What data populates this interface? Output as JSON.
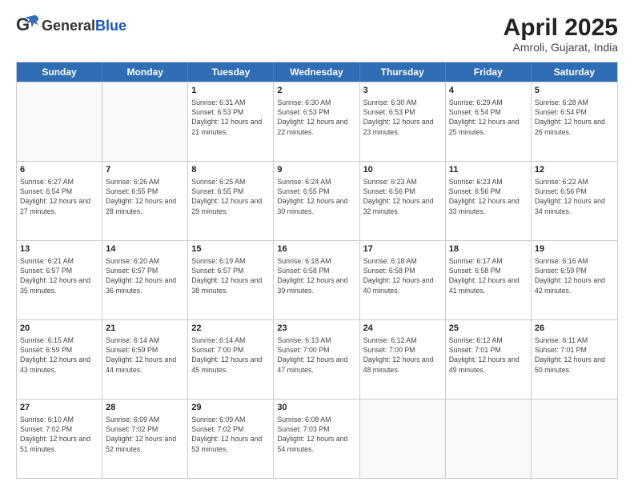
{
  "header": {
    "logo_general": "General",
    "logo_blue": "Blue",
    "month_year": "April 2025",
    "location": "Amroli, Gujarat, India"
  },
  "days_of_week": [
    "Sunday",
    "Monday",
    "Tuesday",
    "Wednesday",
    "Thursday",
    "Friday",
    "Saturday"
  ],
  "weeks": [
    [
      {
        "day": "",
        "sunrise": "",
        "sunset": "",
        "daylight": ""
      },
      {
        "day": "",
        "sunrise": "",
        "sunset": "",
        "daylight": ""
      },
      {
        "day": "1",
        "sunrise": "Sunrise: 6:31 AM",
        "sunset": "Sunset: 6:53 PM",
        "daylight": "Daylight: 12 hours and 21 minutes."
      },
      {
        "day": "2",
        "sunrise": "Sunrise: 6:30 AM",
        "sunset": "Sunset: 6:53 PM",
        "daylight": "Daylight: 12 hours and 22 minutes."
      },
      {
        "day": "3",
        "sunrise": "Sunrise: 6:30 AM",
        "sunset": "Sunset: 6:53 PM",
        "daylight": "Daylight: 12 hours and 23 minutes."
      },
      {
        "day": "4",
        "sunrise": "Sunrise: 6:29 AM",
        "sunset": "Sunset: 6:54 PM",
        "daylight": "Daylight: 12 hours and 25 minutes."
      },
      {
        "day": "5",
        "sunrise": "Sunrise: 6:28 AM",
        "sunset": "Sunset: 6:54 PM",
        "daylight": "Daylight: 12 hours and 26 minutes."
      }
    ],
    [
      {
        "day": "6",
        "sunrise": "Sunrise: 6:27 AM",
        "sunset": "Sunset: 6:54 PM",
        "daylight": "Daylight: 12 hours and 27 minutes."
      },
      {
        "day": "7",
        "sunrise": "Sunrise: 6:26 AM",
        "sunset": "Sunset: 6:55 PM",
        "daylight": "Daylight: 12 hours and 28 minutes."
      },
      {
        "day": "8",
        "sunrise": "Sunrise: 6:25 AM",
        "sunset": "Sunset: 6:55 PM",
        "daylight": "Daylight: 12 hours and 29 minutes."
      },
      {
        "day": "9",
        "sunrise": "Sunrise: 6:24 AM",
        "sunset": "Sunset: 6:55 PM",
        "daylight": "Daylight: 12 hours and 30 minutes."
      },
      {
        "day": "10",
        "sunrise": "Sunrise: 6:23 AM",
        "sunset": "Sunset: 6:56 PM",
        "daylight": "Daylight: 12 hours and 32 minutes."
      },
      {
        "day": "11",
        "sunrise": "Sunrise: 6:23 AM",
        "sunset": "Sunset: 6:56 PM",
        "daylight": "Daylight: 12 hours and 33 minutes."
      },
      {
        "day": "12",
        "sunrise": "Sunrise: 6:22 AM",
        "sunset": "Sunset: 6:56 PM",
        "daylight": "Daylight: 12 hours and 34 minutes."
      }
    ],
    [
      {
        "day": "13",
        "sunrise": "Sunrise: 6:21 AM",
        "sunset": "Sunset: 6:57 PM",
        "daylight": "Daylight: 12 hours and 35 minutes."
      },
      {
        "day": "14",
        "sunrise": "Sunrise: 6:20 AM",
        "sunset": "Sunset: 6:57 PM",
        "daylight": "Daylight: 12 hours and 36 minutes."
      },
      {
        "day": "15",
        "sunrise": "Sunrise: 6:19 AM",
        "sunset": "Sunset: 6:57 PM",
        "daylight": "Daylight: 12 hours and 38 minutes."
      },
      {
        "day": "16",
        "sunrise": "Sunrise: 6:18 AM",
        "sunset": "Sunset: 6:58 PM",
        "daylight": "Daylight: 12 hours and 39 minutes."
      },
      {
        "day": "17",
        "sunrise": "Sunrise: 6:18 AM",
        "sunset": "Sunset: 6:58 PM",
        "daylight": "Daylight: 12 hours and 40 minutes."
      },
      {
        "day": "18",
        "sunrise": "Sunrise: 6:17 AM",
        "sunset": "Sunset: 6:58 PM",
        "daylight": "Daylight: 12 hours and 41 minutes."
      },
      {
        "day": "19",
        "sunrise": "Sunrise: 6:16 AM",
        "sunset": "Sunset: 6:59 PM",
        "daylight": "Daylight: 12 hours and 42 minutes."
      }
    ],
    [
      {
        "day": "20",
        "sunrise": "Sunrise: 6:15 AM",
        "sunset": "Sunset: 6:59 PM",
        "daylight": "Daylight: 12 hours and 43 minutes."
      },
      {
        "day": "21",
        "sunrise": "Sunrise: 6:14 AM",
        "sunset": "Sunset: 6:59 PM",
        "daylight": "Daylight: 12 hours and 44 minutes."
      },
      {
        "day": "22",
        "sunrise": "Sunrise: 6:14 AM",
        "sunset": "Sunset: 7:00 PM",
        "daylight": "Daylight: 12 hours and 45 minutes."
      },
      {
        "day": "23",
        "sunrise": "Sunrise: 6:13 AM",
        "sunset": "Sunset: 7:00 PM",
        "daylight": "Daylight: 12 hours and 47 minutes."
      },
      {
        "day": "24",
        "sunrise": "Sunrise: 6:12 AM",
        "sunset": "Sunset: 7:00 PM",
        "daylight": "Daylight: 12 hours and 48 minutes."
      },
      {
        "day": "25",
        "sunrise": "Sunrise: 6:12 AM",
        "sunset": "Sunset: 7:01 PM",
        "daylight": "Daylight: 12 hours and 49 minutes."
      },
      {
        "day": "26",
        "sunrise": "Sunrise: 6:11 AM",
        "sunset": "Sunset: 7:01 PM",
        "daylight": "Daylight: 12 hours and 50 minutes."
      }
    ],
    [
      {
        "day": "27",
        "sunrise": "Sunrise: 6:10 AM",
        "sunset": "Sunset: 7:02 PM",
        "daylight": "Daylight: 12 hours and 51 minutes."
      },
      {
        "day": "28",
        "sunrise": "Sunrise: 6:09 AM",
        "sunset": "Sunset: 7:02 PM",
        "daylight": "Daylight: 12 hours and 52 minutes."
      },
      {
        "day": "29",
        "sunrise": "Sunrise: 6:09 AM",
        "sunset": "Sunset: 7:02 PM",
        "daylight": "Daylight: 12 hours and 53 minutes."
      },
      {
        "day": "30",
        "sunrise": "Sunrise: 6:08 AM",
        "sunset": "Sunset: 7:03 PM",
        "daylight": "Daylight: 12 hours and 54 minutes."
      },
      {
        "day": "",
        "sunrise": "",
        "sunset": "",
        "daylight": ""
      },
      {
        "day": "",
        "sunrise": "",
        "sunset": "",
        "daylight": ""
      },
      {
        "day": "",
        "sunrise": "",
        "sunset": "",
        "daylight": ""
      }
    ]
  ]
}
